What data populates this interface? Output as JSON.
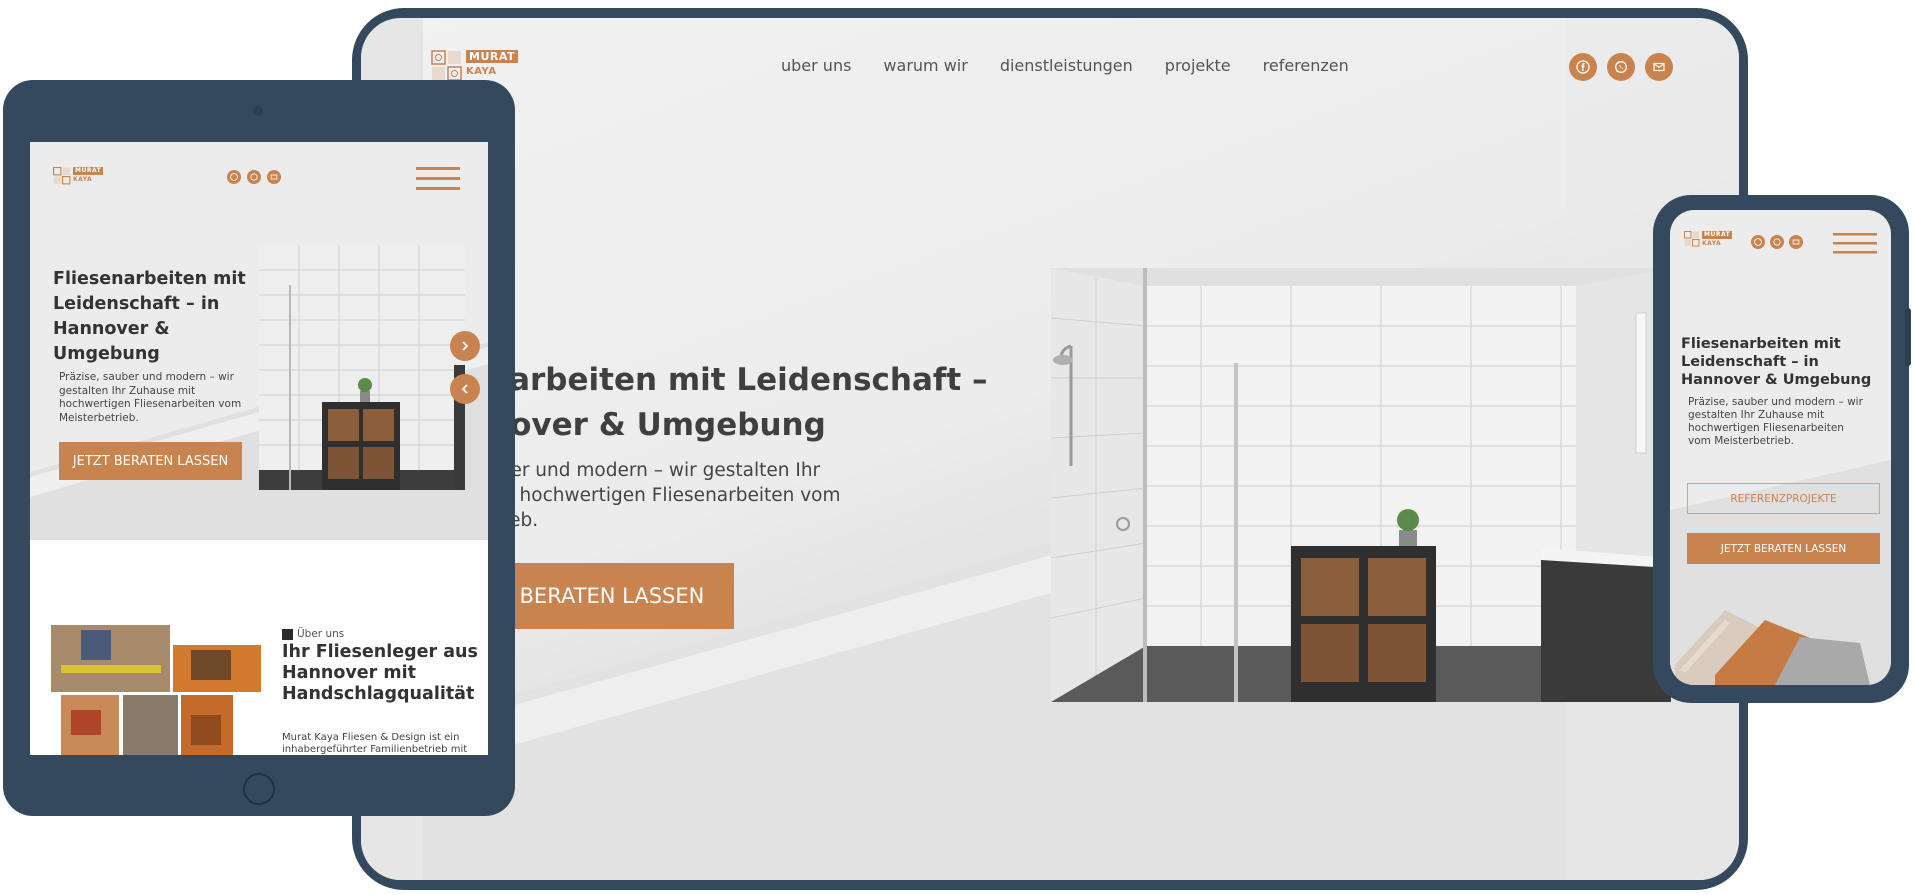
{
  "colors": {
    "accent": "#c9834f",
    "frame": "#34495e",
    "text_dark": "#333333"
  },
  "brand": {
    "line1": "MURAT",
    "line2": "KAYA"
  },
  "desktop": {
    "nav": [
      "uber uns",
      "warum wir",
      "dienstleistungen",
      "projekte",
      "referenzen"
    ],
    "social_icons": [
      "facebook-icon",
      "whatsapp-icon",
      "email-icon"
    ],
    "hero_title_line1": "enarbeiten mit Leidenschaft –",
    "hero_title_line2": "nnover & Umgebung",
    "hero_text_line1": "sauber und modern – wir gestalten Ihr",
    "hero_text_line2": "e mit hochwertigen Fliesenarbeiten vom",
    "hero_text_line3": "betrieb.",
    "cta": "ZT BERATEN LASSEN"
  },
  "tablet": {
    "hero_title": "Fliesenarbeiten mit Leidenschaft – in Hannover & Umgebung",
    "hero_text": "Präzise, sauber und modern – wir gestalten Ihr Zuhause mit hochwertigen Fliesenarbeiten vom Meisterbetrieb.",
    "cta": "JETZT BERATEN LASSEN",
    "slider_icons": [
      "chevron-right-icon",
      "chevron-left-icon"
    ],
    "about_eyebrow": "Über uns",
    "about_title": "Ihr Fliesenleger aus Hannover mit Handschlagqualität",
    "about_text": "Murat Kaya Fliesen & Design ist ein inhabergeführter Familienbetrieb mit"
  },
  "phone": {
    "hero_title": "Fliesenarbeiten mit Leidenschaft – in Hannover & Umgebung",
    "hero_text": "Präzise, sauber und modern – wir gestalten Ihr Zuhause mit hochwertigen Fliesenarbeiten vom Meisterbetrieb.",
    "secondary_cta": "REFERENZPROJEKTE",
    "cta": "JETZT BERATEN LASSEN"
  }
}
